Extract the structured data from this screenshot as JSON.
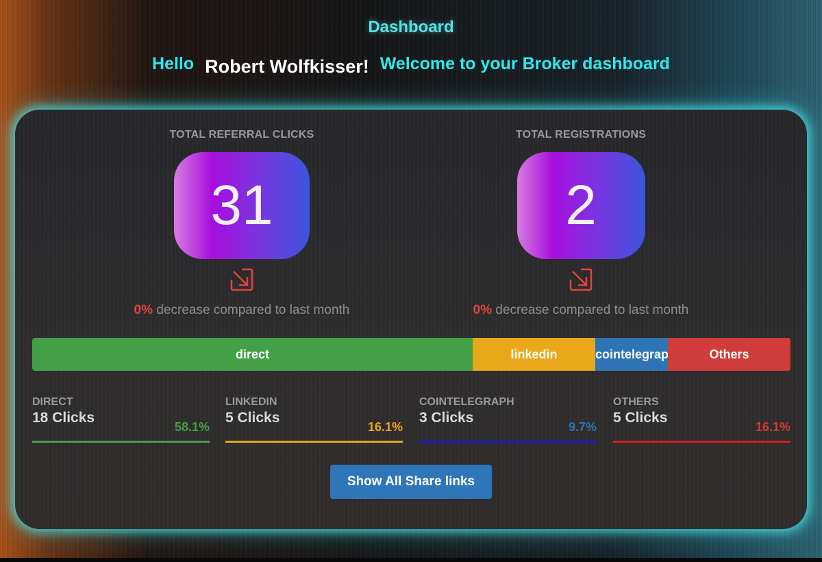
{
  "header": {
    "title": "Dashboard",
    "greeting_prefix": "Hello",
    "user_name": "Robert Wolfkisser!",
    "greeting_suffix": "Welcome to your Broker dashboard"
  },
  "stats": [
    {
      "label": "TOTAL REFERRAL CLICKS",
      "value": "31",
      "icon": "arrow-down-right-icon",
      "change_pct": "0%",
      "change_text": "decrease compared to last month"
    },
    {
      "label": "TOTAL REGISTRATIONS",
      "value": "2",
      "icon": "arrow-down-right-icon",
      "change_pct": "0%",
      "change_text": "decrease compared to last month"
    }
  ],
  "distribution_bar": {
    "segments": [
      {
        "label": "direct",
        "share": 0.581,
        "color": "#43a047"
      },
      {
        "label": "linkedin",
        "share": 0.161,
        "color": "#e9a71a"
      },
      {
        "label": "cointelegraph",
        "share": 0.097,
        "color": "#2e74b5"
      },
      {
        "label": "Others",
        "share": 0.161,
        "color": "#d03c3a"
      }
    ]
  },
  "sources": [
    {
      "title": "DIRECT",
      "clicks": "18 Clicks",
      "pct": "58.1%",
      "color": "#43a047",
      "line_color": "#43a047"
    },
    {
      "title": "LINKEDIN",
      "clicks": "5 Clicks",
      "pct": "16.1%",
      "color": "#e9a71a",
      "line_color": "#e9a71a"
    },
    {
      "title": "COINTELEGRAPH",
      "clicks": "3 Clicks",
      "pct": "9.7%",
      "color": "#2e74b5",
      "line_color": "#1a1ad0"
    },
    {
      "title": "OTHERS",
      "clicks": "5 Clicks",
      "pct": "16.1%",
      "color": "#d03c3a",
      "line_color": "#d41f1f"
    }
  ],
  "actions": {
    "show_all_label": "Show All Share links"
  },
  "colors": {
    "title": "#56e1e8",
    "greeting": "#2fe9ef",
    "glow": "#46dce1",
    "decrease": "#e0453d",
    "button": "#2f76b9"
  }
}
